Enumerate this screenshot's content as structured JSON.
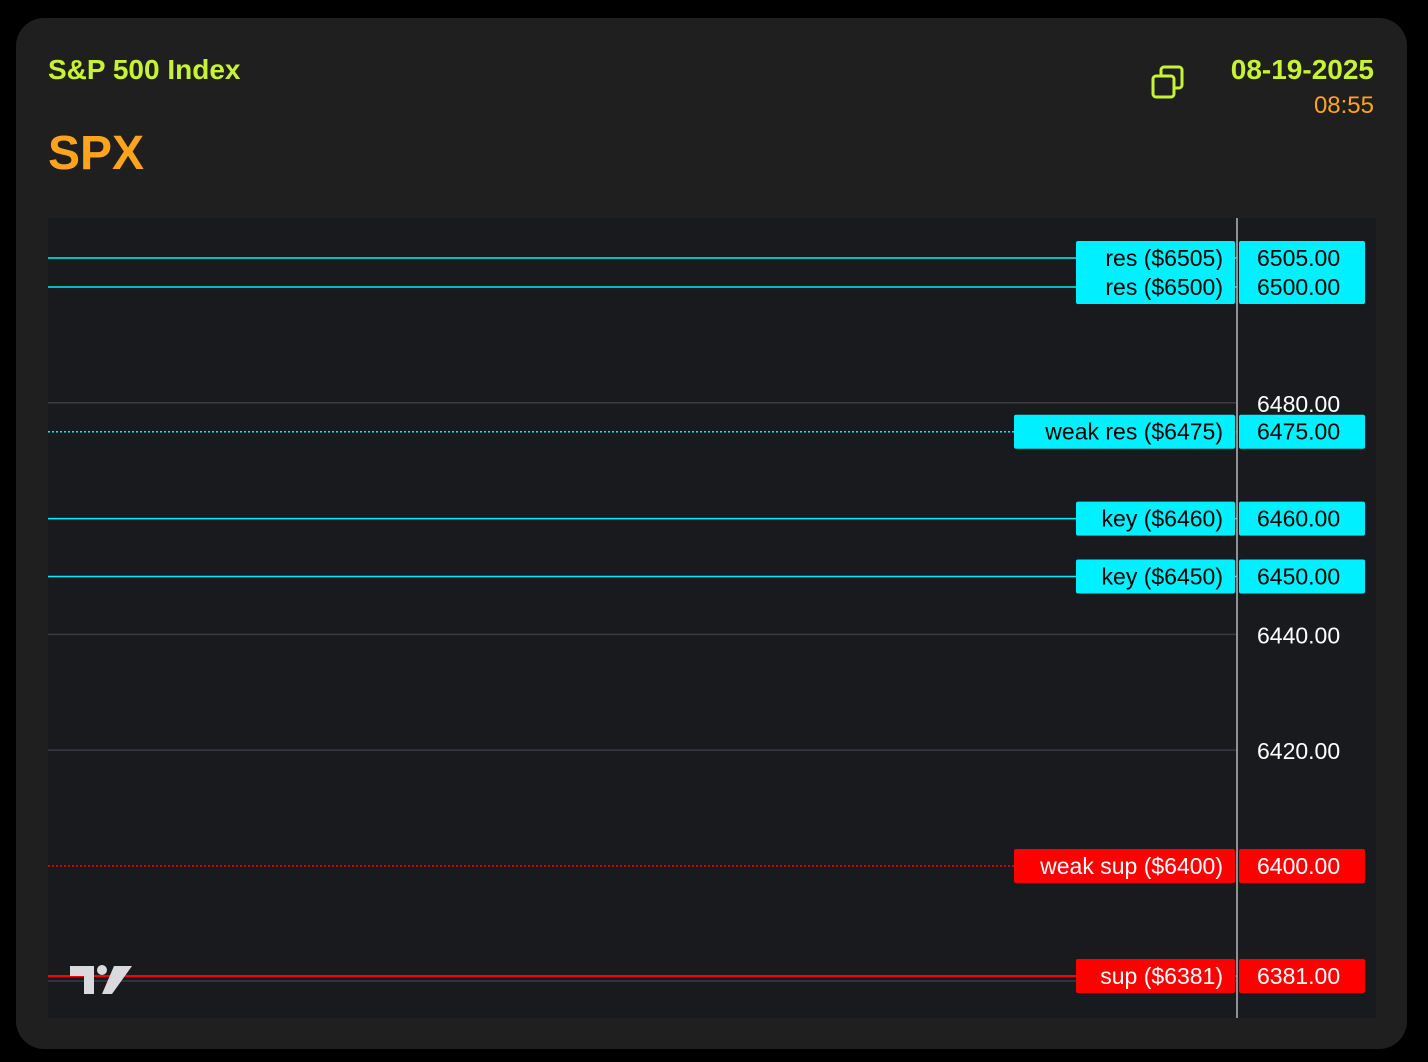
{
  "header": {
    "index_name": "S&P 500 Index",
    "ticker": "SPX",
    "date": "08-19-2025",
    "time": "08:55",
    "copy_icon": "copy-icon"
  },
  "colors": {
    "resistance": "#00f0ff",
    "support": "#ff0000",
    "grid": "#3a3b40",
    "axis_text": "#ffffff",
    "brand_green": "#c6f432",
    "brand_orange": "#ffa41c"
  },
  "chart_data": {
    "type": "line",
    "ylim": [
      6378,
      6512
    ],
    "y_ticks": [
      {
        "value": 6480,
        "label": "6480.00"
      },
      {
        "value": 6440,
        "label": "6440.00"
      },
      {
        "value": 6420,
        "label": "6420.00"
      }
    ],
    "levels": [
      {
        "value": 6505,
        "label": "res ($6505)",
        "price": "6505.00",
        "kind": "resistance",
        "style": "solid"
      },
      {
        "value": 6500,
        "label": "res ($6500)",
        "price": "6500.00",
        "kind": "resistance",
        "style": "solid"
      },
      {
        "value": 6475,
        "label": "weak res ($6475)",
        "price": "6475.00",
        "kind": "resistance",
        "style": "dotted"
      },
      {
        "value": 6460,
        "label": "key ($6460)",
        "price": "6460.00",
        "kind": "resistance",
        "style": "solid"
      },
      {
        "value": 6450,
        "label": "key ($6450)",
        "price": "6450.00",
        "kind": "resistance",
        "style": "solid"
      },
      {
        "value": 6400,
        "label": "weak sup ($6400)",
        "price": "6400.00",
        "kind": "support",
        "style": "dotted"
      },
      {
        "value": 6381,
        "label": "sup ($6381)",
        "price": "6381.00",
        "kind": "support",
        "style": "solid"
      }
    ],
    "watermark": "tradingview-logo"
  }
}
